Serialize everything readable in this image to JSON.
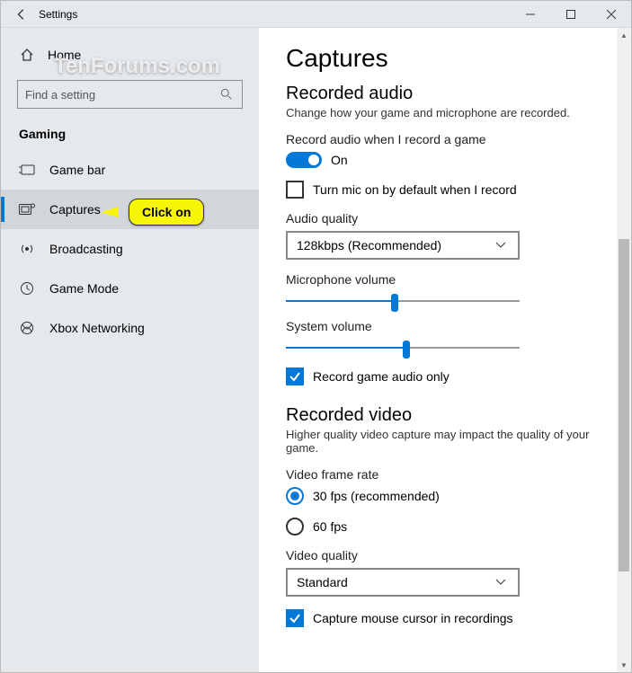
{
  "titlebar": {
    "title": "Settings"
  },
  "sidebar": {
    "home": "Home",
    "search_placeholder": "Find a setting",
    "section": "Gaming",
    "items": [
      {
        "label": "Game bar"
      },
      {
        "label": "Captures"
      },
      {
        "label": "Broadcasting"
      },
      {
        "label": "Game Mode"
      },
      {
        "label": "Xbox Networking"
      }
    ]
  },
  "main": {
    "title": "Captures",
    "audio": {
      "heading": "Recorded audio",
      "desc": "Change how your game and microphone are recorded.",
      "record_label": "Record audio when I record a game",
      "toggle_state": "On",
      "mic_default": "Turn mic on by default when I record",
      "quality_label": "Audio quality",
      "quality_value": "128kbps (Recommended)",
      "mic_volume_label": "Microphone volume",
      "mic_volume": 45,
      "sys_volume_label": "System volume",
      "sys_volume": 50,
      "game_audio_only": "Record game audio only"
    },
    "video": {
      "heading": "Recorded video",
      "desc": "Higher quality video capture may impact the quality of your game.",
      "framerate_label": "Video frame rate",
      "fps30": "30 fps (recommended)",
      "fps60": "60 fps",
      "quality_label": "Video quality",
      "quality_value": "Standard",
      "cursor": "Capture mouse cursor in recordings"
    }
  },
  "callout": "Click on",
  "watermark": "TenForums.com"
}
